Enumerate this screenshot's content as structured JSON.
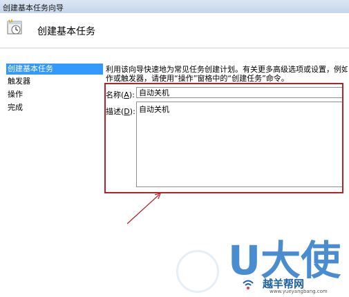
{
  "window": {
    "title": "创建基本任务向导"
  },
  "header": {
    "title": "创建基本任务"
  },
  "nav": {
    "items": [
      "创建基本任务",
      "触发器",
      "操作",
      "完成"
    ]
  },
  "main": {
    "description_line1": "利用该向导快速地为常见任务创建计划。有关更多高级选项或设置，例如多任务操",
    "description_line2": "作或触发器，请使用“操作”窗格中的“创建任务”命令。",
    "name_label_text": "名称(",
    "name_label_key": "A",
    "name_label_end": "):",
    "name_value": "自动关机",
    "desc_label_text": "描述(",
    "desc_label_key": "D",
    "desc_label_end": "):",
    "desc_value": "自动关机"
  },
  "watermark": {
    "text": "U大使",
    "site_name": "越羊帮网",
    "url": "www.yueyangbang.com"
  },
  "colors": {
    "highlight": "#b5202a",
    "nav_active": "#3399ff"
  }
}
